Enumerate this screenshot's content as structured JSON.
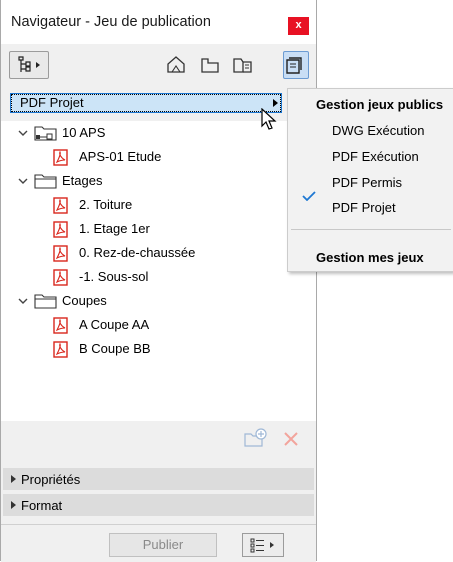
{
  "window": {
    "title": "Navigateur - Jeu de publication",
    "close_label": "x"
  },
  "toolbar": {
    "buttons": [
      {
        "icon": "project-map-icon"
      },
      {
        "icon": "view-map-icon"
      },
      {
        "icon": "layout-book-icon"
      },
      {
        "icon": "publisher-sets-icon",
        "active": true
      }
    ]
  },
  "set_selector": {
    "value": "PDF Projet"
  },
  "tree": {
    "items": [
      {
        "label": "10 APS",
        "type": "folder-link",
        "expanded": true
      },
      {
        "label": "APS-01 Etude",
        "type": "pdf"
      },
      {
        "label": "Etages",
        "type": "folder",
        "expanded": true
      },
      {
        "label": "2. Toiture",
        "type": "pdf"
      },
      {
        "label": "1. Etage 1er",
        "type": "pdf"
      },
      {
        "label": "0. Rez-de-chaussée",
        "type": "pdf"
      },
      {
        "label": "-1. Sous-sol",
        "type": "pdf"
      },
      {
        "label": "Coupes",
        "type": "folder",
        "expanded": true
      },
      {
        "label": "A Coupe AA",
        "type": "pdf"
      },
      {
        "label": "B Coupe BB",
        "type": "pdf"
      }
    ]
  },
  "sections": {
    "properties": "Propriétés",
    "format": "Format"
  },
  "footer": {
    "publish_label": "Publier"
  },
  "menu": {
    "header_public": "Gestion jeux publics",
    "items": [
      "DWG Exécution",
      "PDF Exécution",
      "PDF Permis",
      "PDF Projet"
    ],
    "checked": "PDF Projet",
    "header_mine": "Gestion mes jeux"
  },
  "colors": {
    "accent": "#1e78d2",
    "pdf_red": "#d9261c",
    "close_red": "#e81123",
    "selection": "#cce4f7"
  }
}
